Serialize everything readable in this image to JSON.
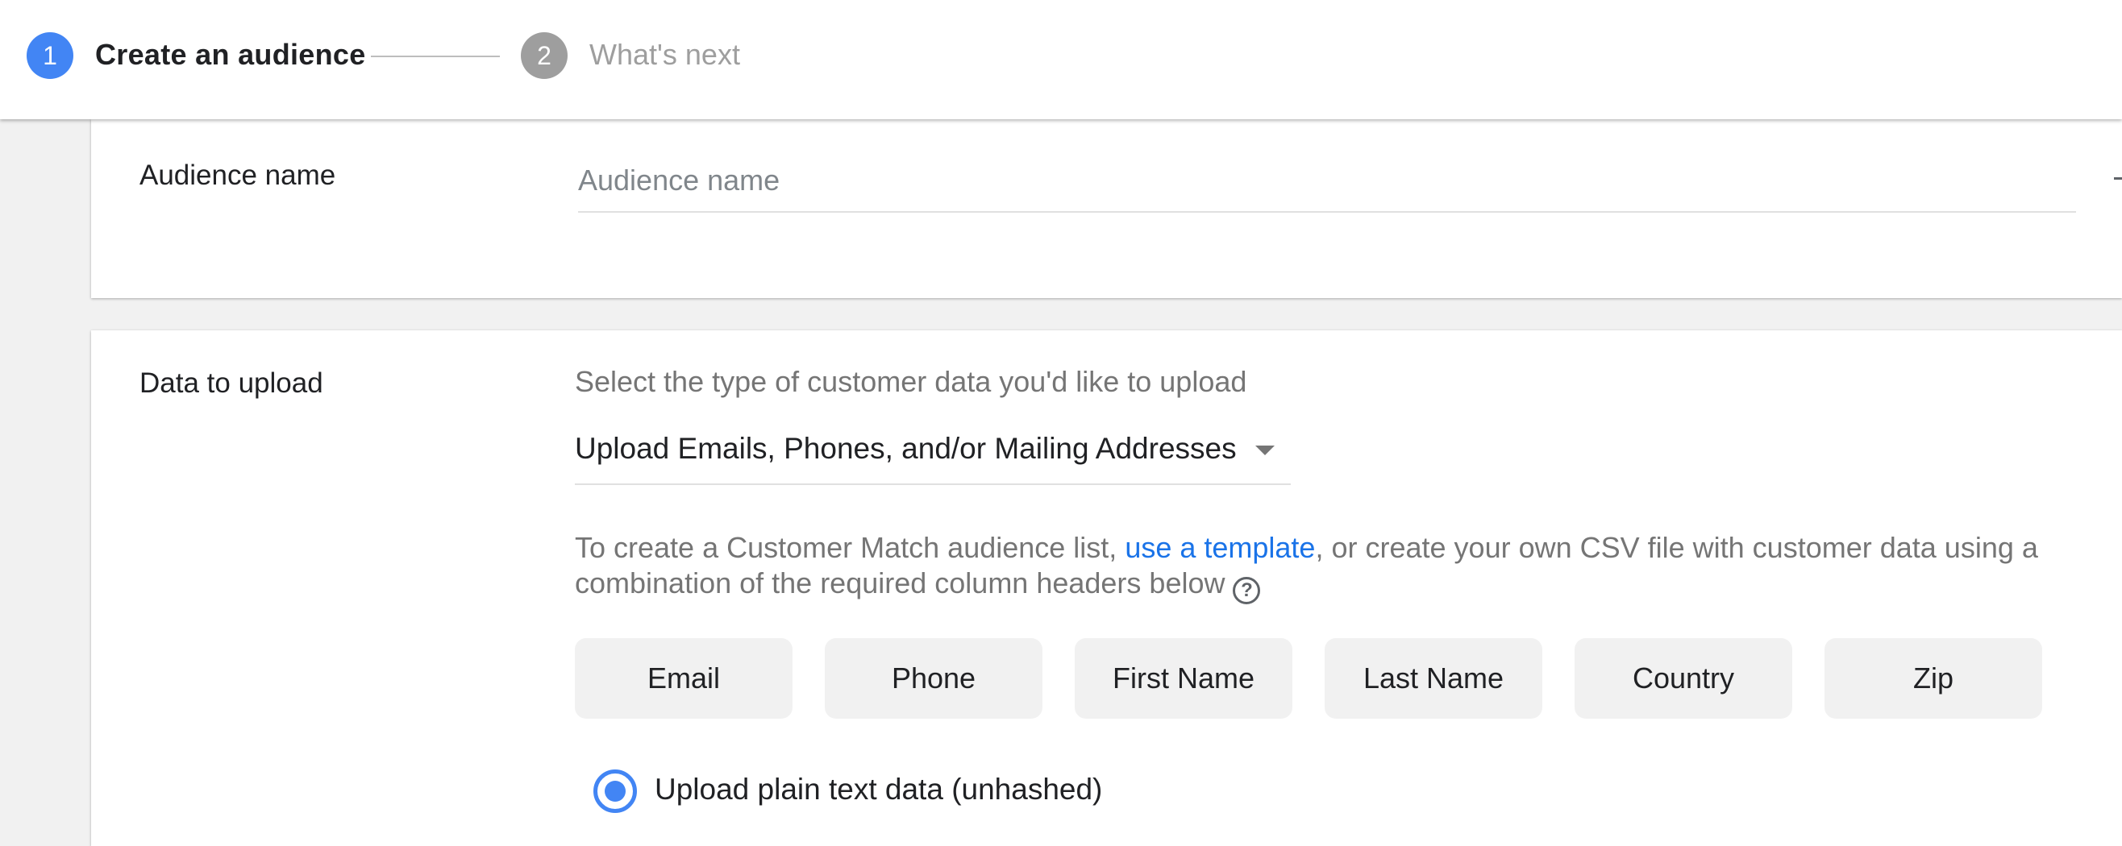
{
  "stepper": {
    "steps": [
      {
        "number": "1",
        "label": "Create an audience",
        "state": "active"
      },
      {
        "number": "2",
        "label": "What's next",
        "state": "inactive"
      }
    ]
  },
  "audience_name": {
    "label": "Audience name",
    "placeholder": "Audience name",
    "value": ""
  },
  "data_upload": {
    "label": "Data to upload",
    "hint": "Select the type of customer data you'd like to upload",
    "dropdown_value": "Upload Emails, Phones, and/or Mailing Addresses",
    "info_before_link": "To create a Customer Match audience list, ",
    "info_link": "use a template",
    "info_after_link": ", or create your own CSV file with customer data using a combination of the required column headers below",
    "help_glyph": "?",
    "columns": [
      "Email",
      "Phone",
      "First Name",
      "Last Name",
      "Country",
      "Zip"
    ],
    "radio_label": "Upload plain text data (unhashed)"
  },
  "colors": {
    "accent": "#4285f4",
    "link": "#1a73e8",
    "muted_text": "#757575",
    "chip_bg": "#f1f1f1"
  }
}
